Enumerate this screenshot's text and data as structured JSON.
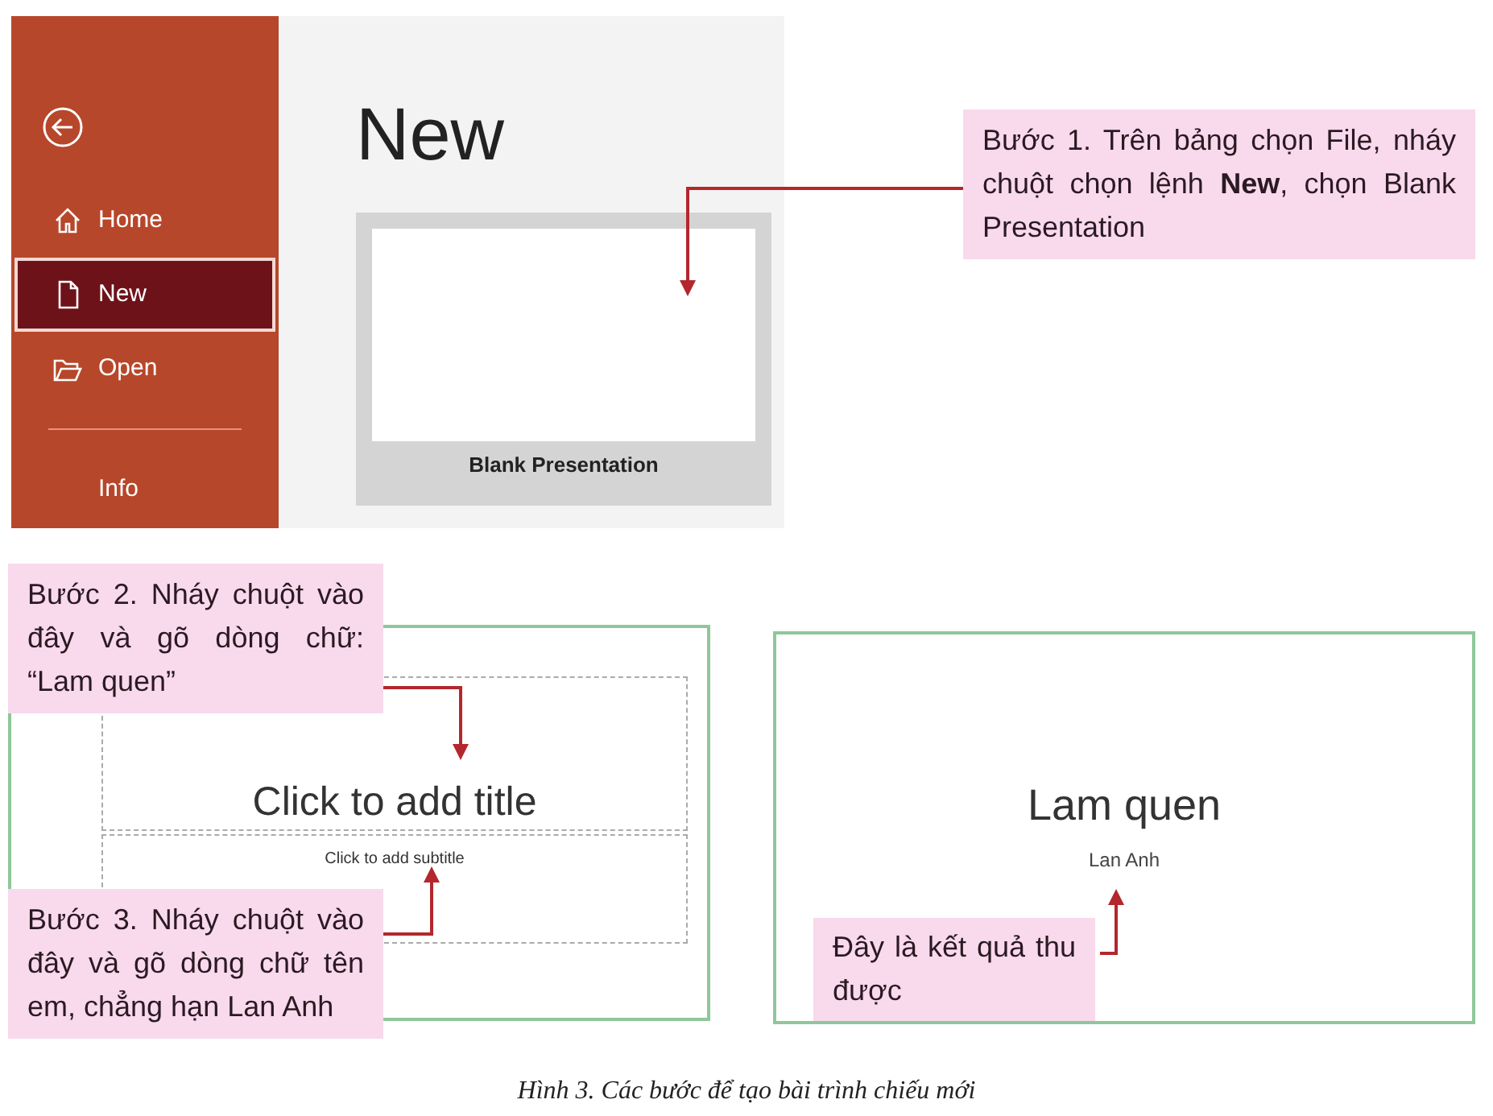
{
  "backstage": {
    "menu": [
      {
        "label": "Home",
        "selected": false
      },
      {
        "label": "New",
        "selected": true
      },
      {
        "label": "Open",
        "selected": false
      },
      {
        "label": "Info",
        "selected": false
      }
    ],
    "heading": "New",
    "template": {
      "label": "Blank Presentation"
    }
  },
  "slides": [
    {
      "kind": "placeholder",
      "title": "Click to add title",
      "subtitle": "Click to add subtitle"
    },
    {
      "kind": "result",
      "title": "Lam quen",
      "subtitle": "Lan Anh"
    }
  ],
  "callouts": [
    {
      "text": "Bước 1. Trên bảng chọn File, nháy chuột chọn lệnh **New**, chọn Blank Presentation"
    },
    {
      "text": "Bước 2. Nháy chuột vào đây và gõ dòng chữ: “Lam quen”"
    },
    {
      "text": "Bước 3. Nháy chuột vào đây và gõ dòng chữ tên em, chẳng hạn Lan Anh"
    },
    {
      "text": "Đây là kết quả thu được"
    }
  ],
  "caption": "Hình 3. Các bước để tạo bài trình chiếu mới"
}
